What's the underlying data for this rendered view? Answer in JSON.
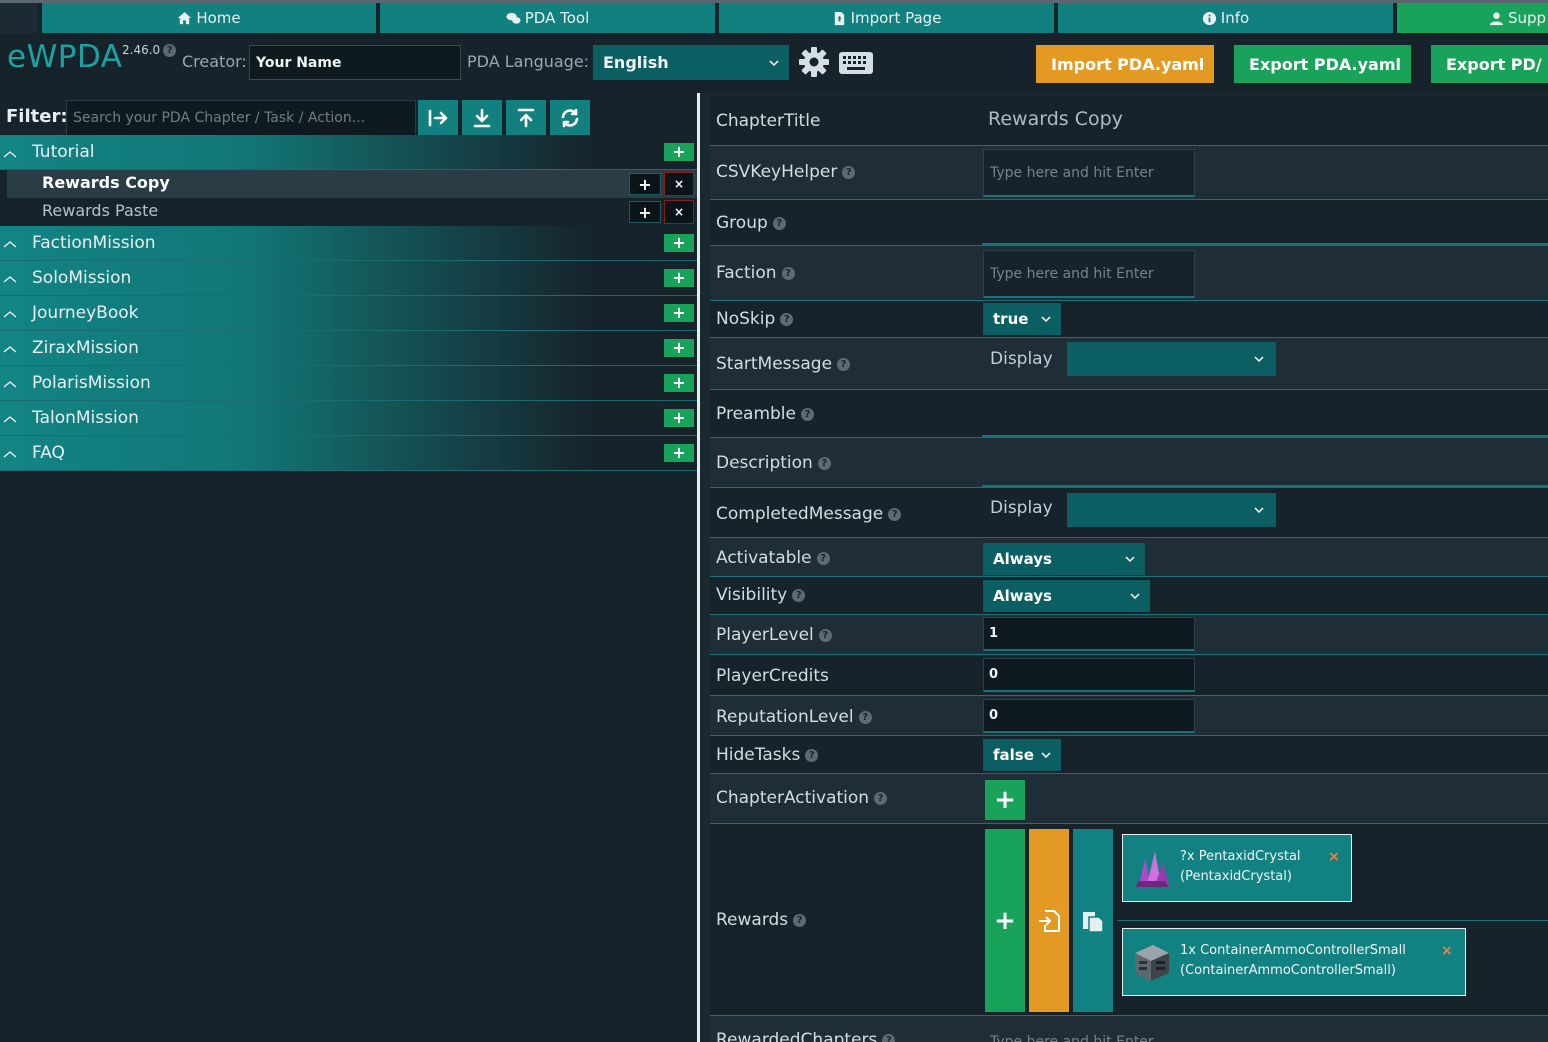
{
  "nav": {
    "tabs": [
      {
        "label": "Home",
        "icon": "home-icon"
      },
      {
        "label": "PDA Tool",
        "icon": "chat-icon"
      },
      {
        "label": "Import Page",
        "icon": "file-import-icon"
      },
      {
        "label": "Info",
        "icon": "info-icon"
      },
      {
        "label": "Supp",
        "icon": "user-icon"
      }
    ]
  },
  "header": {
    "logo": "eWPDA",
    "version": "2.46.0",
    "creator_label": "Creator:",
    "creator_value": "Your Name",
    "language_label": "PDA Language:",
    "language_value": "English",
    "import_label": "Import PDA.yaml",
    "export_label": "Export PDA.yaml",
    "export2_label": "Export PD/"
  },
  "filter": {
    "label": "Filter:",
    "placeholder": "Search your PDA Chapter / Task / Action..."
  },
  "tree": {
    "chapters": [
      {
        "label": "Tutorial"
      },
      {
        "label": "FactionMission"
      },
      {
        "label": "SoloMission"
      },
      {
        "label": "JourneyBook"
      },
      {
        "label": "ZiraxMission"
      },
      {
        "label": "PolarisMission"
      },
      {
        "label": "TalonMission"
      },
      {
        "label": "FAQ"
      }
    ],
    "tutorial_children": [
      {
        "label": "Rewards Copy",
        "active": true
      },
      {
        "label": "Rewards Paste",
        "active": false
      }
    ]
  },
  "form": {
    "chapter_title_label": "ChapterTitle",
    "chapter_title_value": "Rewards Copy",
    "csv_label": "CSVKeyHelper",
    "csv_placeholder": "Type here and hit Enter",
    "group_label": "Group",
    "faction_label": "Faction",
    "faction_placeholder": "Type here and hit Enter",
    "noskip_label": "NoSkip",
    "noskip_value": "true",
    "start_message_label": "StartMessage",
    "display_label": "Display",
    "preamble_label": "Preamble",
    "description_label": "Description",
    "completed_message_label": "CompletedMessage",
    "completed_display_label": "Display",
    "activatable_label": "Activatable",
    "activatable_value": "Always",
    "visibility_label": "Visibility",
    "visibility_value": "Always",
    "player_level_label": "PlayerLevel",
    "player_level_value": "1",
    "player_credits_label": "PlayerCredits",
    "player_credits_value": "0",
    "reputation_label": "ReputationLevel",
    "reputation_value": "0",
    "hide_tasks_label": "HideTasks",
    "hide_tasks_value": "false",
    "chapter_activation_label": "ChapterActivation",
    "rewards_label": "Rewards",
    "rewarded_chapters_label": "RewardedChapters",
    "rewarded_chapters_placeholder": "Type here and hit Enter"
  },
  "rewards": [
    {
      "line1": "?x PentaxidCrystal",
      "line2": "(PentaxidCrystal)",
      "icon": "pentaxid-crystal-icon"
    },
    {
      "line1": "1x ContainerAmmoControllerSmall",
      "line2": "(ContainerAmmoControllerSmall)",
      "icon": "ammo-container-icon"
    }
  ],
  "colors": {
    "teal": "#138080",
    "green": "#19a25a",
    "orange": "#e29a23",
    "background": "#16232b"
  }
}
